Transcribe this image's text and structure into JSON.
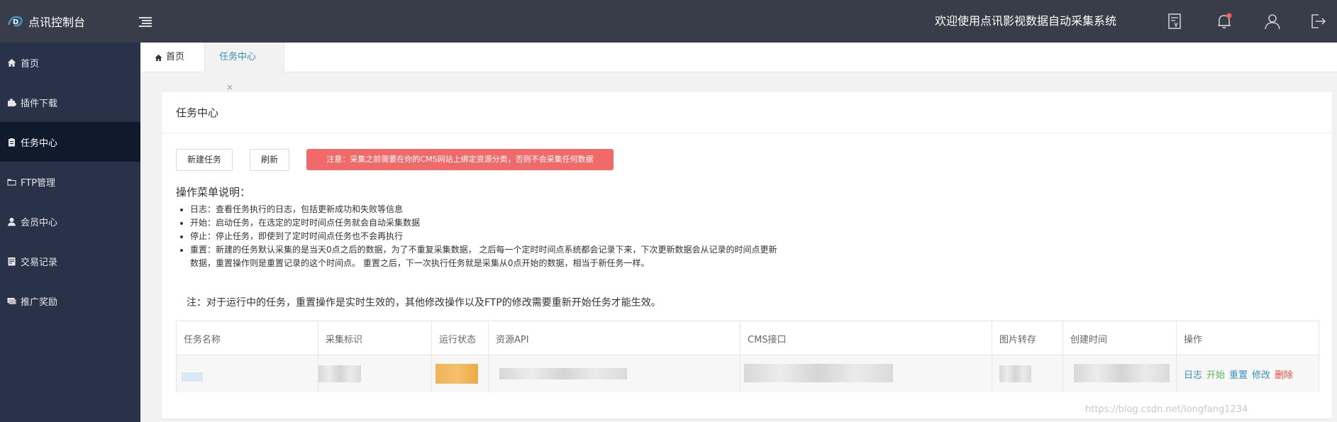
{
  "header": {
    "app_name": "点讯控制台",
    "welcome": "欢迎使用点讯影视数据自动采集系统"
  },
  "sidebar": {
    "items": [
      {
        "label": "首页"
      },
      {
        "label": "插件下载"
      },
      {
        "label": "任务中心"
      },
      {
        "label": "FTP管理"
      },
      {
        "label": "会员中心"
      },
      {
        "label": "交易记录"
      },
      {
        "label": "推广奖励"
      }
    ]
  },
  "tabs": {
    "home": "首页",
    "task": "任务中心",
    "close": "×"
  },
  "card": {
    "title": "任务中心",
    "new_task": "新建任务",
    "refresh": "刷新",
    "notice": "注意：采集之前需要在你的CMS网站上绑定资源分类，否则不会采集任何数据"
  },
  "description": {
    "title": "操作菜单说明：",
    "items": [
      "日志：查看任务执行的日志，包括更新成功和失败等信息",
      "开始：启动任务，在选定的定时时间点任务就会自动采集数据",
      "停止：停止任务，即使到了定时时间点任务也不会再执行",
      "重置：新建的任务默认采集的是当天0点之后的数据，为了不重复采集数据， 之后每一个定时时间点系统都会记录下来，下次更新数据会从记录的时间点更新数据，重置操作则是重置记录的这个时间点。 重置之后，下一次执行任务就是采集从0点开始的数据，相当于新任务一样。"
    ],
    "remark": "注：对于运行中的任务，重置操作是实时生效的，其他修改操作以及FTP的修改需要重新开始任务才能生效。"
  },
  "table": {
    "headers": [
      "任务名称",
      "采集标识",
      "运行状态",
      "资源API",
      "CMS接口",
      "图片转存",
      "创建时间",
      "操作"
    ],
    "actions": [
      {
        "label": "日志",
        "color": "#3c8dbc"
      },
      {
        "label": "开始",
        "color": "#5cb85c"
      },
      {
        "label": "重置",
        "color": "#3c8dbc"
      },
      {
        "label": "修改",
        "color": "#3c8dbc"
      },
      {
        "label": "删除",
        "color": "#e74c3c"
      }
    ]
  },
  "watermark": "https://blog.csdn.net/longfang1234"
}
